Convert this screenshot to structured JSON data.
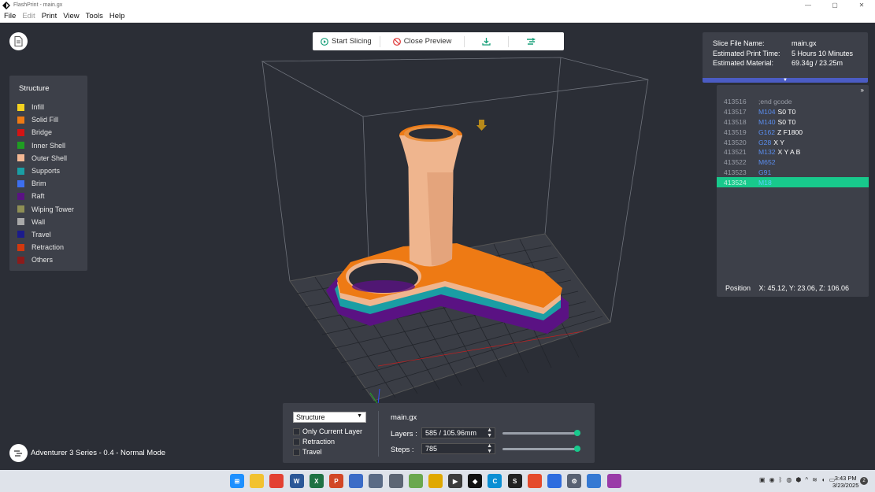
{
  "window": {
    "title": "FlashPrint - main.gx",
    "minimize": "—",
    "maximize": "▢",
    "close": "✕"
  },
  "menu": [
    {
      "label": "File",
      "enabled": true
    },
    {
      "label": "Edit",
      "enabled": false
    },
    {
      "label": "Print",
      "enabled": true
    },
    {
      "label": "View",
      "enabled": true
    },
    {
      "label": "Tools",
      "enabled": true
    },
    {
      "label": "Help",
      "enabled": true
    }
  ],
  "toolbar": {
    "start_slicing": "Start Slicing",
    "close_preview": "Close Preview",
    "export_icon": "download-icon",
    "print_icon": "printer-send-icon"
  },
  "legend": {
    "title": "Structure",
    "items": [
      {
        "label": "Infill",
        "color": "#f5d21f"
      },
      {
        "label": "Solid Fill",
        "color": "#ee7a14"
      },
      {
        "label": "Bridge",
        "color": "#d31414"
      },
      {
        "label": "Inner Shell",
        "color": "#1f9d22"
      },
      {
        "label": "Outer Shell",
        "color": "#f4b894"
      },
      {
        "label": "Supports",
        "color": "#1a9ea4"
      },
      {
        "label": "Brim",
        "color": "#3d6ff0"
      },
      {
        "label": "Raft",
        "color": "#5a1283"
      },
      {
        "label": "Wiping Tower",
        "color": "#8e8f55"
      },
      {
        "label": "Wall",
        "color": "#a9a9a9"
      },
      {
        "label": "Travel",
        "color": "#1b1b8c"
      },
      {
        "label": "Retraction",
        "color": "#d2380e"
      },
      {
        "label": "Others",
        "color": "#8c1b1b"
      }
    ]
  },
  "slice_info": {
    "file_name_label": "Slice File Name:",
    "file_name": "main.gx",
    "time_label": "Estimated Print Time:",
    "time": "5 Hours 10 Minutes",
    "material_label": "Estimated Material:",
    "material": "69.34g / 23.25m",
    "expand": "▼"
  },
  "gcode": {
    "collapse": "»",
    "lines": [
      {
        "num": "413516",
        "cmd": "",
        "cmt": ";end gcode",
        "args": ""
      },
      {
        "num": "413517",
        "cmd": "M104",
        "cmt": "",
        "args": "S0 T0"
      },
      {
        "num": "413518",
        "cmd": "M140",
        "cmt": "",
        "args": "S0 T0"
      },
      {
        "num": "413519",
        "cmd": "G162",
        "cmt": "",
        "args": "Z F1800"
      },
      {
        "num": "413520",
        "cmd": "G28",
        "cmt": "",
        "args": "X Y"
      },
      {
        "num": "413521",
        "cmd": "M132",
        "cmt": "",
        "args": "X Y A B"
      },
      {
        "num": "413522",
        "cmd": "M652",
        "cmt": "",
        "args": ""
      },
      {
        "num": "413523",
        "cmd": "G91",
        "cmt": "",
        "args": ""
      },
      {
        "num": "413524",
        "cmd": "M18",
        "cmt": "",
        "args": ""
      }
    ],
    "selected_index": 8,
    "position_label": "Position",
    "position": "X: 45.12, Y: 23.06, Z: 106.06"
  },
  "controls": {
    "view_mode": "Structure",
    "only_current_layer": "Only Current Layer",
    "retraction": "Retraction",
    "travel": "Travel",
    "file": "main.gx",
    "layers_label": "Layers :",
    "layers_value": "585 / 105.96mm",
    "steps_label": "Steps :",
    "steps_value": "785",
    "layers_progress": 1.0,
    "steps_progress": 1.0
  },
  "machine": {
    "label": "Adventurer 3 Series - 0.4 - Normal Mode"
  },
  "taskbar": {
    "apps": [
      {
        "name": "windows-start-icon",
        "color": "#1e90ff",
        "glyph": "⊞"
      },
      {
        "name": "file-explorer-icon",
        "color": "#f2c230",
        "glyph": ""
      },
      {
        "name": "chrome-icon",
        "color": "#e34133",
        "glyph": ""
      },
      {
        "name": "word-icon",
        "color": "#2b5797",
        "glyph": "W"
      },
      {
        "name": "excel-icon",
        "color": "#1f7244",
        "glyph": "X"
      },
      {
        "name": "powerpoint-icon",
        "color": "#d24726",
        "glyph": "P"
      },
      {
        "name": "notes-icon",
        "color": "#3b6cc7",
        "glyph": ""
      },
      {
        "name": "calculator-icon",
        "color": "#5a6b85",
        "glyph": ""
      },
      {
        "name": "camera-icon",
        "color": "#5d6674",
        "glyph": ""
      },
      {
        "name": "photos-icon",
        "color": "#6aa84f",
        "glyph": ""
      },
      {
        "name": "browser-icon",
        "color": "#e0a800",
        "glyph": ""
      },
      {
        "name": "media-icon",
        "color": "#3c3c3c",
        "glyph": "▶"
      },
      {
        "name": "flashprint-icon",
        "color": "#111111",
        "glyph": "◆"
      },
      {
        "name": "app-c-icon",
        "color": "#0b8fd4",
        "glyph": "C"
      },
      {
        "name": "app-s-icon",
        "color": "#222222",
        "glyph": "S"
      },
      {
        "name": "app-red-icon",
        "color": "#e54b2c",
        "glyph": ""
      },
      {
        "name": "app-blue-icon",
        "color": "#2d6cdf",
        "glyph": ""
      },
      {
        "name": "settings-icon",
        "color": "#596273",
        "glyph": "⚙"
      },
      {
        "name": "editor-icon",
        "color": "#3579d3",
        "glyph": ""
      },
      {
        "name": "snip-icon",
        "color": "#9a3ba8",
        "glyph": ""
      }
    ],
    "time": "3:43 PM",
    "date": "3/23/2025",
    "notifications": "2"
  }
}
